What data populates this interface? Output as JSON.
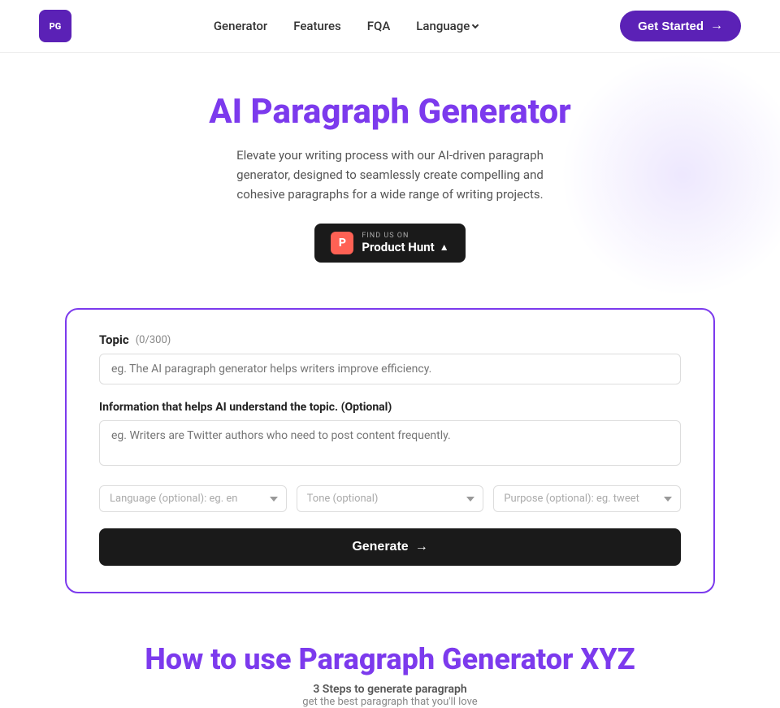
{
  "nav": {
    "logo_text": "PG",
    "links": [
      "Generator",
      "Features",
      "FQA"
    ],
    "language_label": "Language",
    "get_started_label": "Get Started"
  },
  "hero": {
    "title": "AI Paragraph Generator",
    "subtitle": "Elevate your writing process with our AI-driven paragraph generator, designed to seamlessly create compelling and cohesive paragraphs for a wide range of writing projects.",
    "product_hunt": {
      "find_us": "FIND US ON",
      "name": "Product Hunt"
    }
  },
  "form": {
    "topic_label": "Topic",
    "char_count": "(0/300)",
    "topic_placeholder": "eg. The AI paragraph generator helps writers improve efficiency.",
    "optional_label": "Information that helps AI understand the topic. (Optional)",
    "optional_placeholder": "eg. Writers are Twitter authors who need to post content frequently.",
    "language_placeholder": "Language (optional): eg. en",
    "tone_placeholder": "Tone (optional)",
    "purpose_placeholder": "Purpose (optional): eg. tweet",
    "generate_label": "Generate"
  },
  "how_to": {
    "title": "How to use Paragraph Generator XYZ",
    "steps_label": "3 Steps to generate paragraph",
    "subtitle": "get the best paragraph that you'll love"
  },
  "colors": {
    "purple": "#7c3aed",
    "dark": "#1a1a1a"
  }
}
